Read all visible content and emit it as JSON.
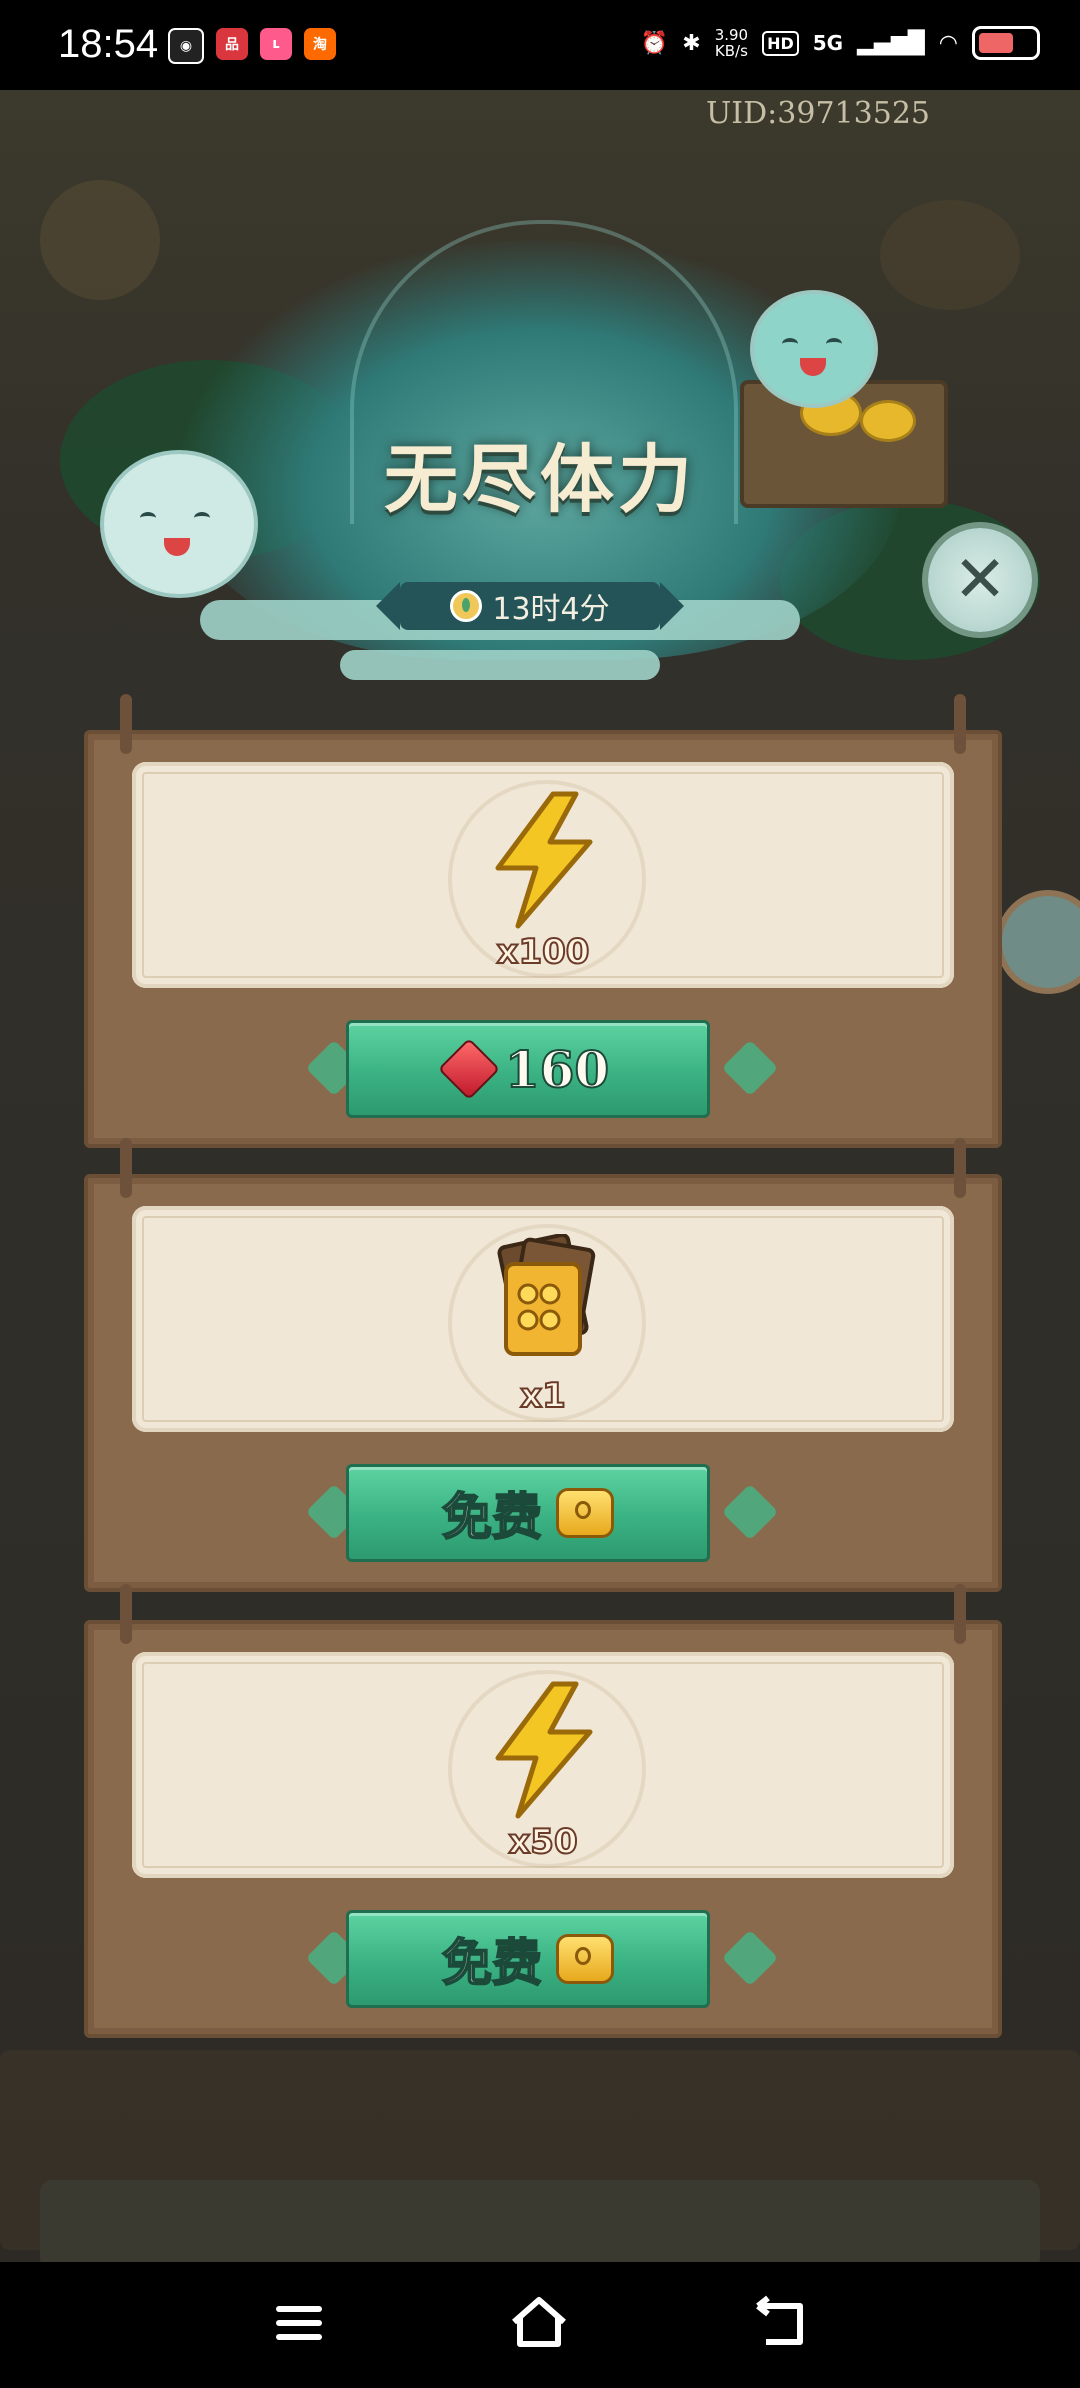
{
  "status_bar": {
    "time": "18:54",
    "app_icons": [
      {
        "name": "android-face-icon",
        "color": "#222222",
        "glyph": "◉"
      },
      {
        "name": "shop-red-icon",
        "color": "#d9363e",
        "glyph": "品"
      },
      {
        "name": "pink-app-icon",
        "color": "#ff5a8c",
        "glyph": "ʟ"
      },
      {
        "name": "taobao-icon",
        "color": "#ff6a00",
        "glyph": "淘"
      }
    ],
    "net_speed_value": "3.90",
    "net_speed_unit": "KB/s",
    "hd_label": "HD",
    "signal_label": "5G"
  },
  "uid": "UID:39713525",
  "header": {
    "title": "无尽体力",
    "timer": "13时4分"
  },
  "offers": [
    {
      "item": "lightning-energy",
      "quantity": "x100",
      "button": {
        "type": "gem",
        "label": "160"
      }
    },
    {
      "item": "ticket-card-pack",
      "quantity": "x1",
      "button": {
        "type": "ad",
        "label": "免费"
      }
    },
    {
      "item": "lightning-energy",
      "quantity": "x50",
      "button": {
        "type": "ad",
        "label": "免费"
      }
    }
  ],
  "colors": {
    "card_wood": "#8a6a4c",
    "paper": "#f1e7d6",
    "button_green": "#3bb283",
    "title_text": "#f5ecd2",
    "gem_red": "#c0192b",
    "lightning_yellow": "#f3c623"
  }
}
